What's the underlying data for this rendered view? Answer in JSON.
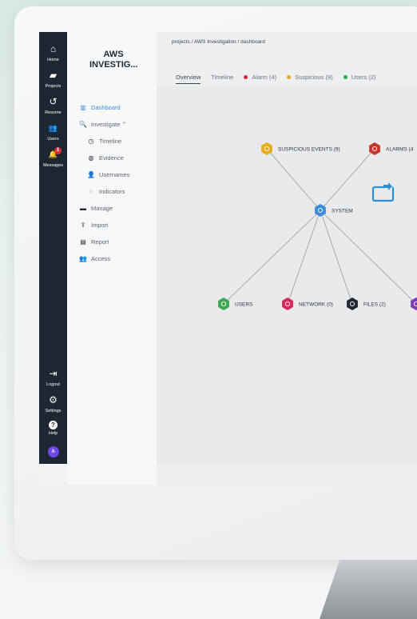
{
  "rail": {
    "items": [
      {
        "icon": "home-icon",
        "glyph": "⌂",
        "label": "Home"
      },
      {
        "icon": "folder-icon",
        "glyph": "▰",
        "label": "Projects"
      },
      {
        "icon": "history-icon",
        "glyph": "↺",
        "label": "Resume"
      },
      {
        "icon": "users-icon",
        "glyph": "👥",
        "label": "Users"
      },
      {
        "icon": "bell-icon",
        "glyph": "🔔",
        "label": "Messages",
        "badge": "1"
      }
    ],
    "bottom": [
      {
        "icon": "logout-icon",
        "glyph": "⇥",
        "label": "Logout"
      },
      {
        "icon": "settings-icon",
        "glyph": "⚙",
        "label": "Settings"
      },
      {
        "icon": "help-icon",
        "glyph": "?",
        "label": "Help"
      }
    ],
    "avatar": "A"
  },
  "nav": {
    "project_title": "AWS INVESTIG...",
    "items": [
      {
        "label": "Dashboard",
        "glyph": "▥",
        "icon": "chart-icon"
      },
      {
        "label": "Investigate ⌃",
        "glyph": "🔍",
        "icon": "search-icon"
      },
      {
        "label": "Timeline",
        "glyph": "◷",
        "icon": "clock-icon"
      },
      {
        "label": "Evidence",
        "glyph": "◍",
        "icon": "fingerprint-icon"
      },
      {
        "label": "Usernames",
        "glyph": "👤",
        "icon": "user-key-icon"
      },
      {
        "label": "Indicators",
        "glyph": "◌",
        "icon": "bulb-icon"
      },
      {
        "label": "Manage",
        "glyph": "▬",
        "icon": "folder-icon"
      },
      {
        "label": "Import",
        "glyph": "⇪",
        "icon": "upload-icon"
      },
      {
        "label": "Report",
        "glyph": "▤",
        "icon": "report-icon"
      },
      {
        "label": "Access",
        "glyph": "👥",
        "icon": "access-icon"
      }
    ]
  },
  "breadcrumb": "projects / AWS Investigation / dashboard",
  "tabs": [
    {
      "label": "Overview"
    },
    {
      "label": "Timeline"
    },
    {
      "label": "Alarm (4)",
      "color": "#d6263b"
    },
    {
      "label": "Suspicious (9)",
      "color": "#e9a922"
    },
    {
      "label": "Users (2)",
      "color": "#2ea84b"
    }
  ],
  "graph": {
    "nodes": [
      {
        "id": "system",
        "label": "SYSTEM",
        "color": "#3c8ad8"
      },
      {
        "id": "suspicious",
        "label": "SUSPICIOUS EVENTS (9)",
        "color": "#e6ac1e"
      },
      {
        "id": "alarms",
        "label": "ALARMS (4",
        "color": "#c7362b"
      },
      {
        "id": "users",
        "label": "USERS",
        "color": "#3fa752"
      },
      {
        "id": "network",
        "label": "NETWORK (0)",
        "color": "#d6285a"
      },
      {
        "id": "files",
        "label": "FILES (2)",
        "color": "#1f2933"
      },
      {
        "id": "other",
        "label": "",
        "color": "#7a3fb8"
      }
    ],
    "edges": [
      [
        "system",
        "suspicious"
      ],
      [
        "system",
        "alarms"
      ],
      [
        "system",
        "users"
      ],
      [
        "system",
        "network"
      ],
      [
        "system",
        "files"
      ],
      [
        "system",
        "other"
      ]
    ],
    "refresh_icon": "refresh-icon"
  }
}
